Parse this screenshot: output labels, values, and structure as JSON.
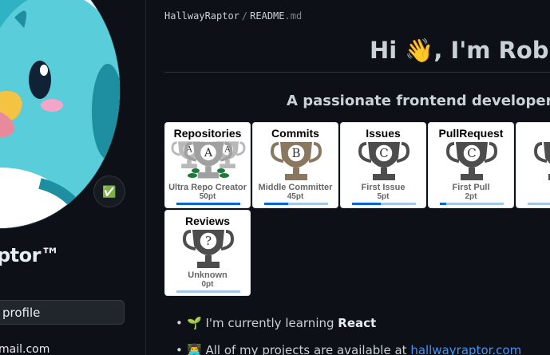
{
  "sidebar": {
    "display_name": "ptor™",
    "status_emoji": "✅",
    "edit_profile_label": "profile",
    "email": "mail.com"
  },
  "breadcrumb": {
    "user": "HallwayRaptor",
    "separator": "/",
    "file_base": "README",
    "file_ext": ".md"
  },
  "readme": {
    "greeting": "Hi 👋, I'm Rob",
    "tagline": "A passionate frontend developer from",
    "items": [
      {
        "emoji": "🌱",
        "text": "I'm currently learning ",
        "strong": "React"
      },
      {
        "emoji": "👨‍💻",
        "text": "All of my projects are available at ",
        "link": "hallwayraptor.com"
      }
    ]
  },
  "trophies": [
    {
      "title": "Repositories",
      "rank": "Ultra Repo Creator",
      "points": "50pt",
      "grade": "A",
      "level": "ultra",
      "progress": 1.0
    },
    {
      "title": "Commits",
      "rank": "Middle Committer",
      "points": "45pt",
      "grade": "B",
      "level": "bronze",
      "progress": 0.38
    },
    {
      "title": "Issues",
      "rank": "First Issue",
      "points": "5pt",
      "grade": "C",
      "level": "gray",
      "progress": 0.45
    },
    {
      "title": "PullRequest",
      "rank": "First Pull",
      "points": "2pt",
      "grade": "C",
      "level": "gray",
      "progress": 0.1
    },
    {
      "title": "S",
      "rank": "Ur",
      "points": "",
      "grade": "",
      "level": "gray",
      "progress": 0.0
    },
    {
      "title": "Reviews",
      "rank": "Unknown",
      "points": "0pt",
      "grade": "?",
      "level": "gray",
      "progress": 0.0
    }
  ],
  "colors": {
    "background": "#0d1117",
    "text": "#e6edf3",
    "link": "#4493f8",
    "trophy_gray": "#4d4d4d",
    "trophy_bronze": "#8a7760",
    "trophy_ultra": "#b8b8b8",
    "laurel": "#1a7a3a"
  }
}
